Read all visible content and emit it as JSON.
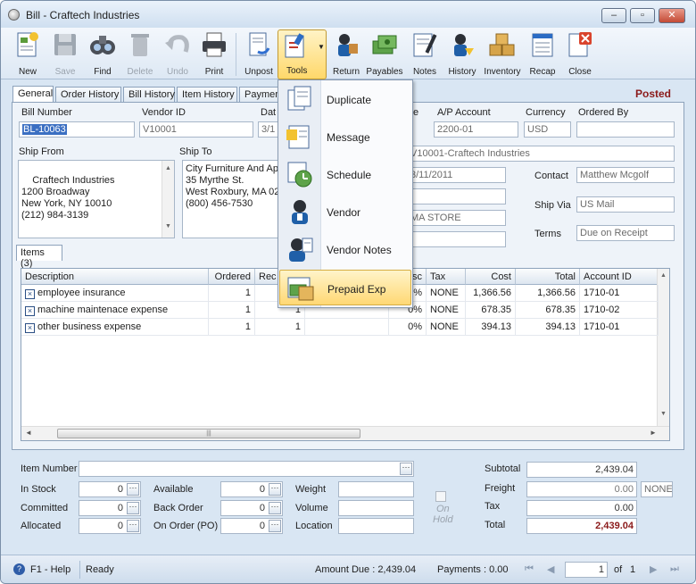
{
  "window": {
    "title": "Bill - Craftech Industries",
    "minimize": "–",
    "maximize": "▫",
    "close": "✕"
  },
  "toolbar": {
    "new": "New",
    "save": "Save",
    "find": "Find",
    "delete": "Delete",
    "undo": "Undo",
    "print": "Print",
    "unpost": "Unpost",
    "tools": "Tools",
    "return": "Return",
    "payables": "Payables",
    "notes": "Notes",
    "history": "History",
    "inventory": "Inventory",
    "recap": "Recap",
    "close": "Close"
  },
  "tabs": [
    "General",
    "Order History",
    "Bill History",
    "Item History",
    "Payment"
  ],
  "status_badge": "Posted",
  "header": {
    "bill_number_label": "Bill Number",
    "bill_number": "BL-10063",
    "vendor_id_label": "Vendor ID",
    "vendor_id": "V10001",
    "date_label": "Dat",
    "date": "3/1",
    "type_label": "e",
    "ap_account_label": "A/P Account",
    "ap_account": "2200-01",
    "currency_label": "Currency",
    "currency": "USD",
    "ordered_by_label": "Ordered By",
    "ordered_by": "",
    "vendor_name": "V10001-Craftech Industries",
    "ship_from_label": "Ship From",
    "ship_from": "Craftech Industries\n1200 Broadway\nNew York, NY 10010\n(212) 984-3139",
    "ship_to_label": "Ship To",
    "ship_to": "City Furniture And Ap\n35 Myrthe St.\nWest Roxbury, MA 02\n(800) 456-7530",
    "date2": "3/11/2011",
    "field_blank1": "",
    "location": "MA STORE",
    "field_blank2": "",
    "contact_label": "Contact",
    "contact": "Matthew Mcgolf",
    "ship_via_label": "Ship Via",
    "ship_via": "US Mail",
    "terms_label": "Terms",
    "terms": "Due on Receipt"
  },
  "items_tab": "Items (3)",
  "grid": {
    "columns": [
      "Description",
      "Ordered",
      "Rec",
      "",
      "isc",
      "Tax",
      "Cost",
      "Total",
      "Account ID"
    ],
    "rows": [
      {
        "desc": "employee insurance",
        "ordered": "1",
        "rec": "",
        "disc": "0%",
        "tax": "NONE",
        "cost": "1,366.56",
        "total": "1,366.56",
        "account": "1710-01"
      },
      {
        "desc": "machine maintenace expense",
        "ordered": "1",
        "rec": "1",
        "disc": "0%",
        "tax": "NONE",
        "cost": "678.35",
        "total": "678.35",
        "account": "1710-02"
      },
      {
        "desc": "other business expense",
        "ordered": "1",
        "rec": "1",
        "disc": "0%",
        "tax": "NONE",
        "cost": "394.13",
        "total": "394.13",
        "account": "1710-01"
      }
    ]
  },
  "tools_menu": [
    "Duplicate",
    "Message",
    "Schedule",
    "Vendor",
    "Vendor Notes",
    "Prepaid Exp"
  ],
  "bottom": {
    "item_number_label": "Item Number",
    "item_number": "",
    "in_stock_label": "In Stock",
    "in_stock": "0",
    "committed_label": "Committed",
    "committed": "0",
    "allocated_label": "Allocated",
    "allocated": "0",
    "available_label": "Available",
    "available": "0",
    "back_order_label": "Back Order",
    "back_order": "0",
    "on_order_label": "On Order (PO)",
    "on_order": "0",
    "weight_label": "Weight",
    "volume_label": "Volume",
    "location_label": "Location",
    "on_hold_label": "On\nHold",
    "subtotal_label": "Subtotal",
    "subtotal": "2,439.04",
    "freight_label": "Freight",
    "freight": "0.00",
    "freight_tax": "NONE",
    "tax_label": "Tax",
    "tax": "0.00",
    "total_label": "Total",
    "total": "2,439.04",
    "dots": "···"
  },
  "statusbar": {
    "help": "F1 - Help",
    "ready": "Ready",
    "amount_due": "Amount Due : 2,439.04",
    "payments": "Payments : 0.00",
    "page": "1",
    "of": "of",
    "pages": "1"
  }
}
